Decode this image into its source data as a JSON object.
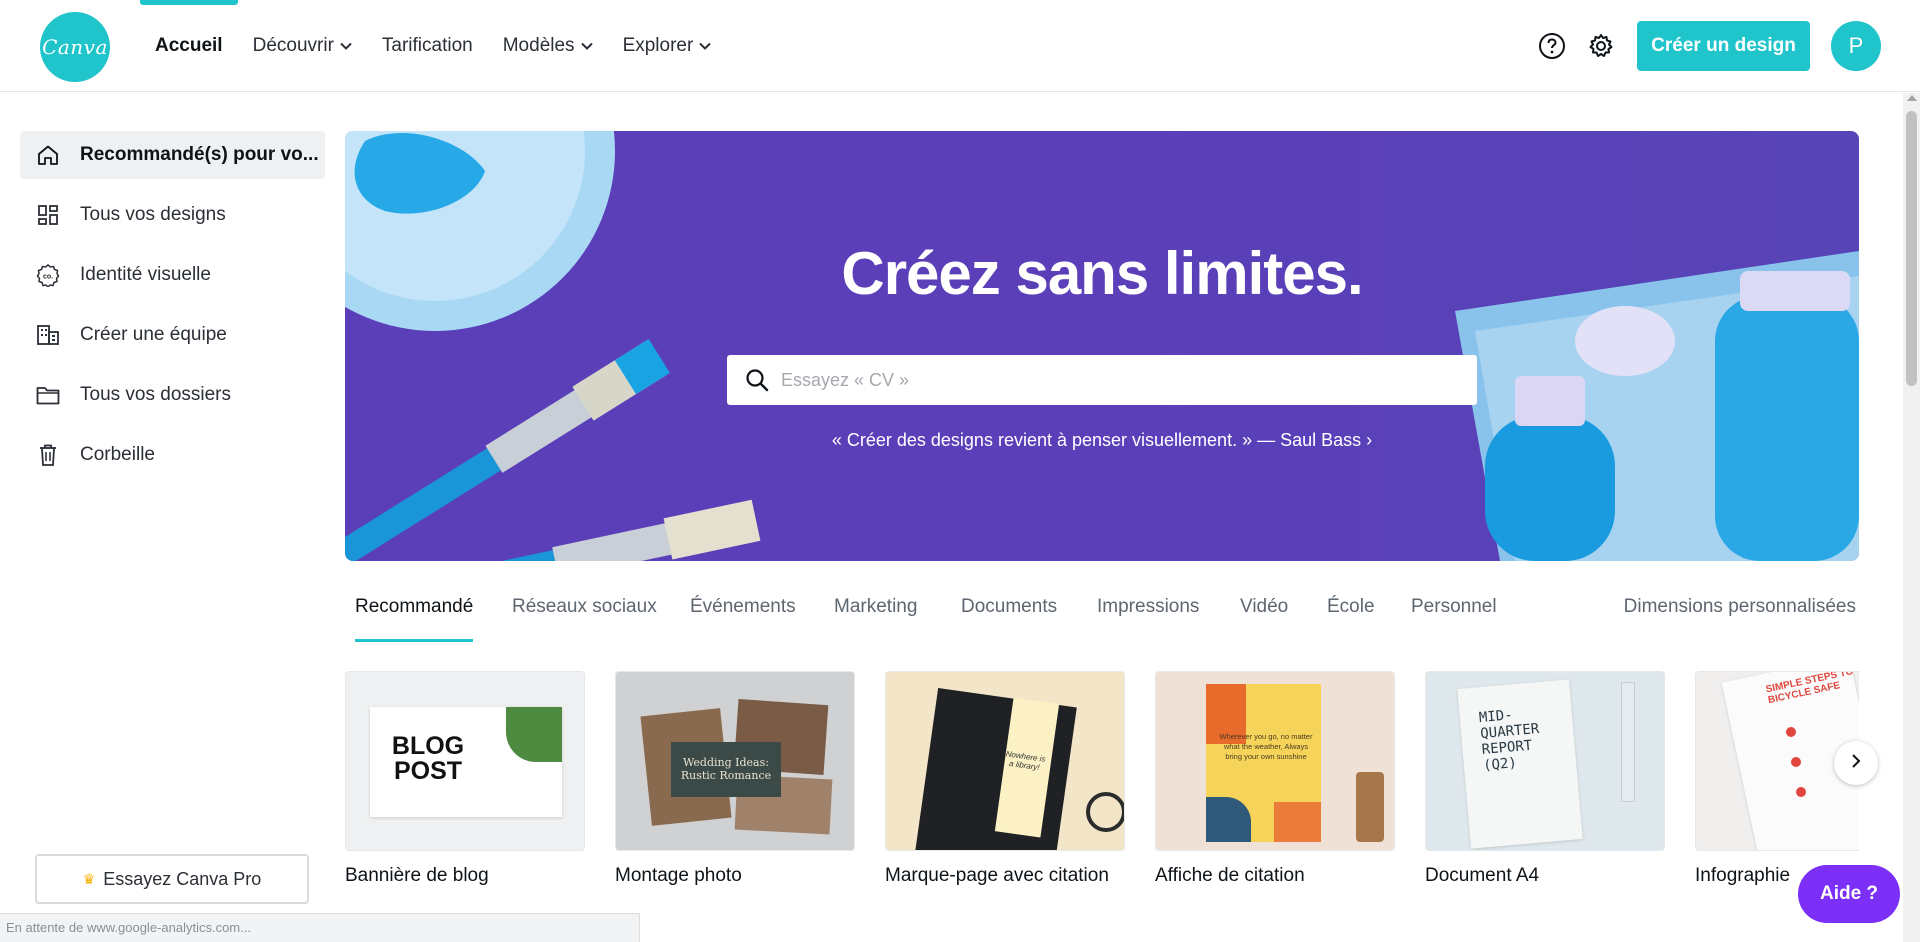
{
  "nav": {
    "logo_text": "Canva",
    "items": [
      {
        "label": "Accueil",
        "active": true,
        "dropdown": false
      },
      {
        "label": "Découvrir",
        "active": false,
        "dropdown": true
      },
      {
        "label": "Tarification",
        "active": false,
        "dropdown": false
      },
      {
        "label": "Modèles",
        "active": false,
        "dropdown": true
      },
      {
        "label": "Explorer",
        "active": false,
        "dropdown": true
      }
    ],
    "create_label": "Créer un design",
    "avatar_initial": "P"
  },
  "sidebar": {
    "items": [
      {
        "label": "Recommandé(s) pour vo...",
        "icon": "home-icon",
        "active": true
      },
      {
        "label": "Tous vos designs",
        "icon": "grid-icon",
        "active": false
      },
      {
        "label": "Identité visuelle",
        "icon": "brand-kit-icon",
        "active": false
      },
      {
        "label": "Créer une équipe",
        "icon": "building-icon",
        "active": false
      },
      {
        "label": "Tous vos dossiers",
        "icon": "folder-icon",
        "active": false
      },
      {
        "label": "Corbeille",
        "icon": "trash-icon",
        "active": false
      }
    ],
    "pro_label": "Essayez Canva Pro"
  },
  "hero": {
    "title": "Créez sans limites.",
    "search_placeholder": "Essayez « CV »",
    "quote": "« Créer des designs revient à penser visuellement. » — Saul Bass ›"
  },
  "tabs": {
    "items": [
      "Recommandé",
      "Réseaux sociaux",
      "Événements",
      "Marketing",
      "Documents",
      "Impressions",
      "Vidéo",
      "École",
      "Personnel"
    ],
    "active": "Recommandé",
    "custom_label": "Dimensions personnalisées"
  },
  "cards": [
    {
      "label": "Bannière de blog",
      "thumb_text": "BLOG POST"
    },
    {
      "label": "Montage photo",
      "thumb_text": "Wedding Ideas: Rustic Romance"
    },
    {
      "label": "Marque-page avec citation",
      "thumb_text": "Nowhere is a library!"
    },
    {
      "label": "Affiche de citation",
      "thumb_text": "Wherever you go, no matter what the weather, Always bring your own sunshine"
    },
    {
      "label": "Document A4",
      "thumb_text": "MID-QUARTER REPORT (Q2)"
    },
    {
      "label": "Infographie",
      "thumb_text": "SIMPLE STEPS TO BICYCLE SAFE"
    }
  ],
  "help_label": "Aide  ?",
  "status_text": "En attente de www.google-analytics.com...",
  "colors": {
    "accent": "#20c4cb",
    "hero_bg": "#5a3fb8",
    "help_button": "#7b2ff7"
  }
}
